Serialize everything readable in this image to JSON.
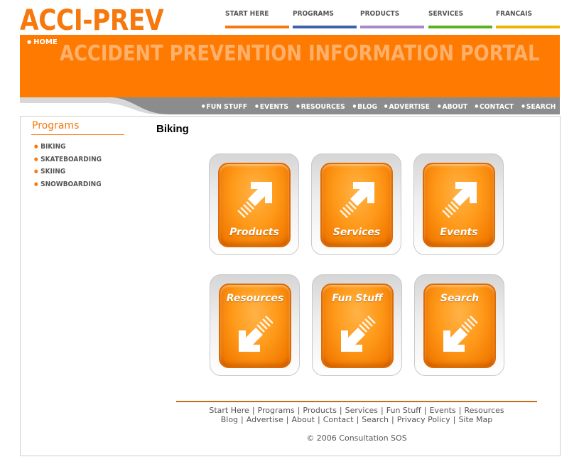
{
  "header": {
    "logo": "ACCI-PREV",
    "home_label": "HOME",
    "portal_title": "ACCIDENT PREVENTION INFORMATION PORTAL"
  },
  "top_nav": [
    {
      "label": "START HERE",
      "color": "#f7780d"
    },
    {
      "label": "PROGRAMS",
      "color": "#3a64a8"
    },
    {
      "label": "PRODUCTS",
      "color": "#a58ac8"
    },
    {
      "label": "SERVICES",
      "color": "#5cb21e"
    },
    {
      "label": "FRANCAIS",
      "color": "#f0b400"
    }
  ],
  "sub_nav": [
    "FUN STUFF",
    "EVENTS",
    "RESOURCES",
    "BLOG",
    "ADVERTISE",
    "ABOUT",
    "CONTACT",
    "SEARCH"
  ],
  "sidebar": {
    "title": "Programs",
    "items": [
      "BIKING",
      "SKATEBOARDING",
      "SKIING",
      "SNOWBOARDING"
    ]
  },
  "main": {
    "heading": "Biking",
    "tiles": [
      {
        "label": "Products",
        "arrow": "arrow-up-right"
      },
      {
        "label": "Services",
        "arrow": "arrow-up-right"
      },
      {
        "label": "Events",
        "arrow": "arrow-up-right"
      },
      {
        "label": "Resources",
        "arrow": "arrow-down-left"
      },
      {
        "label": "Fun Stuff",
        "arrow": "arrow-down-left"
      },
      {
        "label": "Search",
        "arrow": "arrow-down-left"
      }
    ]
  },
  "footer": {
    "row1": [
      "Start Here",
      "Programs",
      "Products",
      "Services",
      "Fun Stuff",
      "Events",
      "Resources"
    ],
    "row2": [
      "Blog",
      "Advertise",
      "About",
      "Contact",
      "Search",
      "Privacy Policy",
      "Site Map"
    ],
    "copyright": "© 2006 Consultation SOS"
  },
  "colors": {
    "brand_orange": "#ff7a00",
    "nav_gray": "#8c8c8c"
  }
}
